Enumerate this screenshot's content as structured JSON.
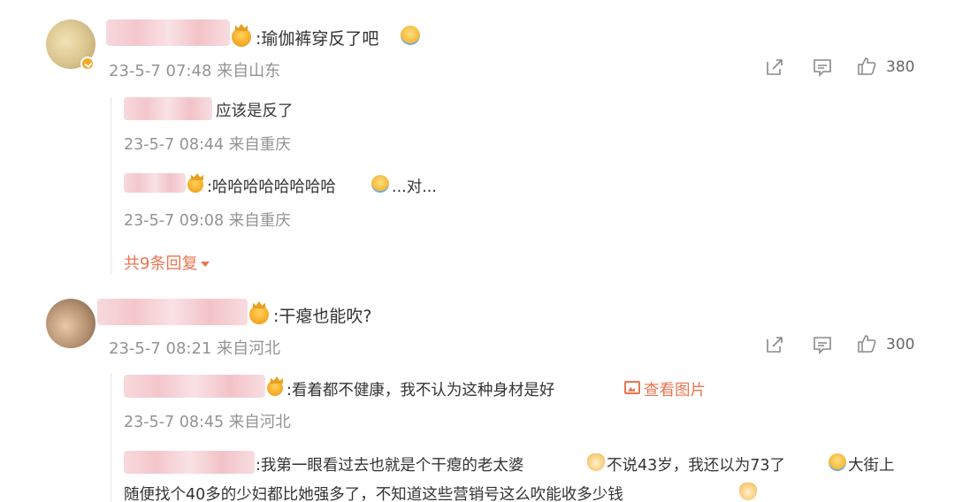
{
  "comments": [
    {
      "text": ":瑜伽裤穿反了吧",
      "meta": "23-5-7 07:48 来自山东",
      "likes": "380",
      "replies": [
        {
          "text": "应该是反了",
          "meta": "23-5-7 08:44 来自重庆"
        },
        {
          "text": ":哈哈哈哈哈哈哈哈",
          "text_tail": "...对...",
          "meta": "23-5-7 09:08 来自重庆"
        }
      ],
      "more_replies": "共9条回复"
    },
    {
      "text": ":干瘪也能吹?",
      "meta": "23-5-7 08:21 来自河北",
      "likes": "300",
      "replies": [
        {
          "text": ":看着都不健康，我不认为这种身材是好",
          "link": "查看图片",
          "meta": "23-5-7 08:45 来自河北"
        },
        {
          "line1_a": ":我第一眼看过去也就是个干瘪的老太婆",
          "line1_b": "不说43岁，我还以为73了",
          "line1_c": "大街上",
          "line2": "随便找个40多的少妇都比她强多了，不知道这些营销号这么吹能收多少钱"
        }
      ]
    }
  ],
  "icons": {
    "share": "share-icon",
    "comment": "comment-icon",
    "like": "thumbs-up-icon",
    "image": "image-icon",
    "caret": "caret-down-icon",
    "verified": "verified-badge-icon"
  },
  "colors": {
    "accent": "#eb7350",
    "meta": "#939393",
    "text": "#333333"
  }
}
